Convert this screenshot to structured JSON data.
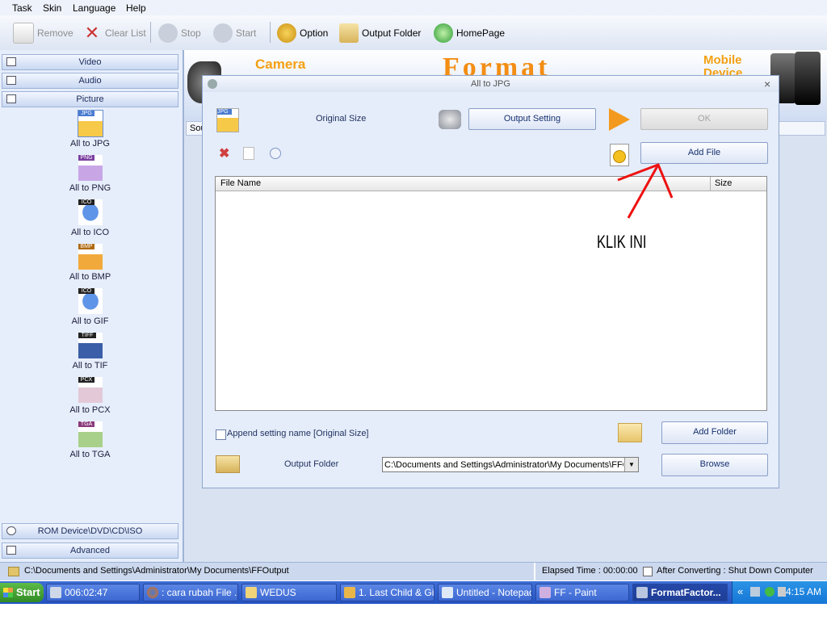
{
  "menu": [
    "Task",
    "Skin",
    "Language",
    "Help"
  ],
  "toolbar": {
    "remove": "Remove",
    "clear_list": "Clear List",
    "stop": "Stop",
    "start": "Start",
    "option": "Option",
    "output_folder": "Output Folder",
    "homepage": "HomePage"
  },
  "sidebar": {
    "categories": [
      "Video",
      "Audio",
      "Picture"
    ],
    "picture_items": [
      {
        "label": "All to JPG",
        "badge": "JPG"
      },
      {
        "label": "All to PNG",
        "badge": "PNG"
      },
      {
        "label": "All to ICO",
        "badge": "ICO"
      },
      {
        "label": "All to BMP",
        "badge": "BMP"
      },
      {
        "label": "All to GIF",
        "badge": "ICO"
      },
      {
        "label": "All to TIF",
        "badge": "TIFF"
      },
      {
        "label": "All to PCX",
        "badge": "PCX"
      },
      {
        "label": "All to TGA",
        "badge": "TGA"
      }
    ],
    "bottom_categories": [
      "ROM Device\\DVD\\CD\\ISO",
      "Advanced"
    ]
  },
  "banner": {
    "camera": "Camera",
    "format": "Format",
    "mobile": "Mobile",
    "device": "Device",
    "partial_tab": "Sou"
  },
  "dialog": {
    "title": "All to JPG",
    "jpg_badge": "JPG",
    "original_size": "Original Size",
    "output_setting": "Output Setting",
    "ok": "OK",
    "add_file": "Add File",
    "columns": {
      "file_name": "File Name",
      "size": "Size"
    },
    "append_setting": "Append setting name [Original Size]",
    "add_folder": "Add Folder",
    "output_folder_label": "Output Folder",
    "output_folder_path": "C:\\Documents and Settings\\Administrator\\My Documents\\FFO",
    "browse": "Browse",
    "close": "×"
  },
  "annotation": {
    "text": "KLIK INI",
    "color": "#ee1111"
  },
  "statusbar": {
    "path": "C:\\Documents and Settings\\Administrator\\My Documents\\FFOutput",
    "elapsed": "Elapsed Time : 00:00:00",
    "after_converting": "After Converting : Shut Down Computer"
  },
  "taskbar": {
    "start": "Start",
    "tasks": [
      "006:02:47",
      ": cara rubah File ...",
      "WEDUS",
      "1. Last Child & Gi...",
      "Untitled - Notepad",
      "FF - Paint",
      "FormatFactor..."
    ],
    "tray_chevron": "«",
    "clock": "4:15 AM"
  },
  "colors": {
    "taskbar": "#2453c2",
    "start_button": "#3c9a33",
    "accent": "#163070"
  }
}
